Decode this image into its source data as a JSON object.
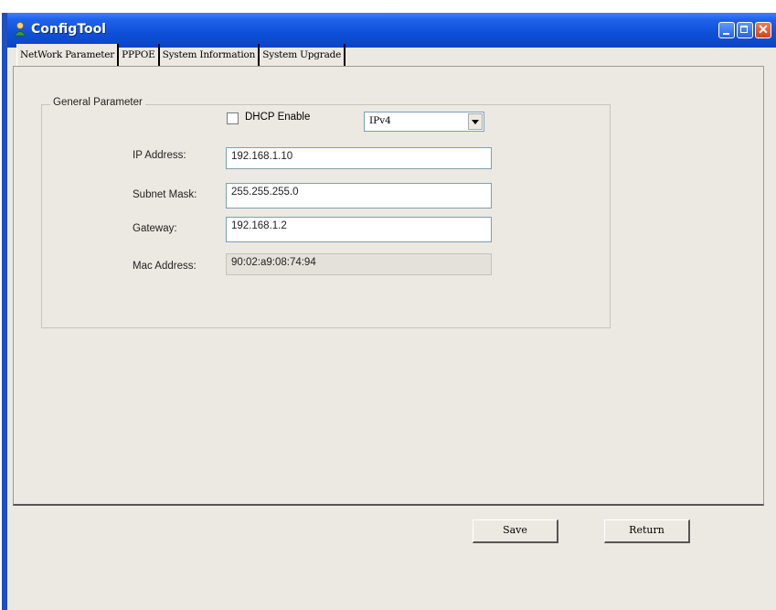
{
  "window": {
    "title": "ConfigTool",
    "app_icon": "user-icon"
  },
  "tabs": [
    {
      "label": "NetWork Parameter",
      "active": true
    },
    {
      "label": "PPPOE",
      "active": false
    },
    {
      "label": "System Information",
      "active": false
    },
    {
      "label": "System Upgrade",
      "active": false
    }
  ],
  "general": {
    "legend": "General Parameter",
    "dhcp_label": "DHCP Enable",
    "dhcp_checked": false,
    "ip_version": "IPv4",
    "ip_label": "IP Address:",
    "ip_value": "192.168.1.10",
    "mask_label": "Subnet Mask:",
    "mask_value": "255.255.255.0",
    "gateway_label": "Gateway:",
    "gateway_value": "192.168.1.2",
    "mac_label": "Mac Address:",
    "mac_value": "90:02:a9:08:74:94"
  },
  "buttons": {
    "save": "Save",
    "return": "Return"
  }
}
